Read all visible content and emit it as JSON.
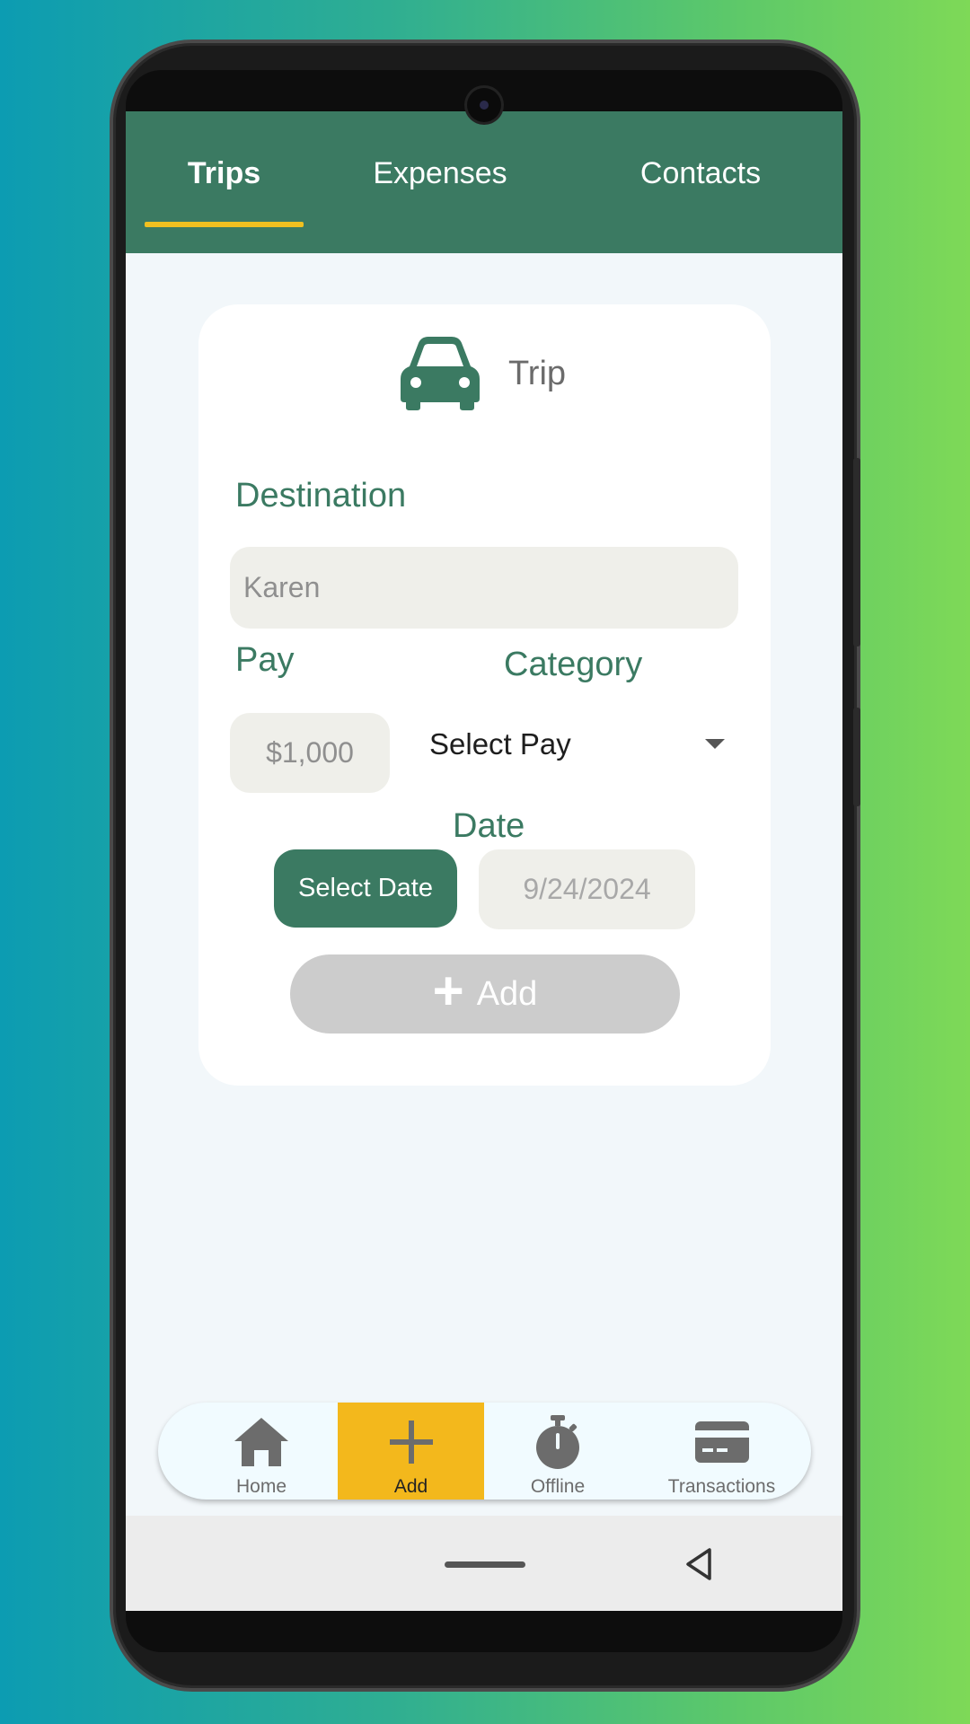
{
  "tabs": [
    {
      "label": "Trips",
      "active": true
    },
    {
      "label": "Expenses",
      "active": false
    },
    {
      "label": "Contacts",
      "active": false
    }
  ],
  "card": {
    "icon": "car-icon",
    "title": "Trip",
    "destination_label": "Destination",
    "destination_value": "Karen",
    "pay_label": "Pay",
    "pay_value": "$1,000",
    "category_label": "Category",
    "category_selected": "Select Pay",
    "date_label": "Date",
    "select_date_button": "Select Date",
    "date_value": "9/24/2024",
    "add_button": "Add"
  },
  "bottom_nav": [
    {
      "label": "Home",
      "icon": "home-icon",
      "active": false
    },
    {
      "label": "Add",
      "icon": "plus-icon",
      "active": true
    },
    {
      "label": "Offline",
      "icon": "stopwatch-icon",
      "active": false
    },
    {
      "label": "Transactions",
      "icon": "credit-card-icon",
      "active": false
    }
  ],
  "colors": {
    "primary": "#3b7a62",
    "accent": "#f3b81c",
    "tab_underline": "#f0c020",
    "input_bg": "#efefea",
    "disabled_button": "#cccccc"
  }
}
